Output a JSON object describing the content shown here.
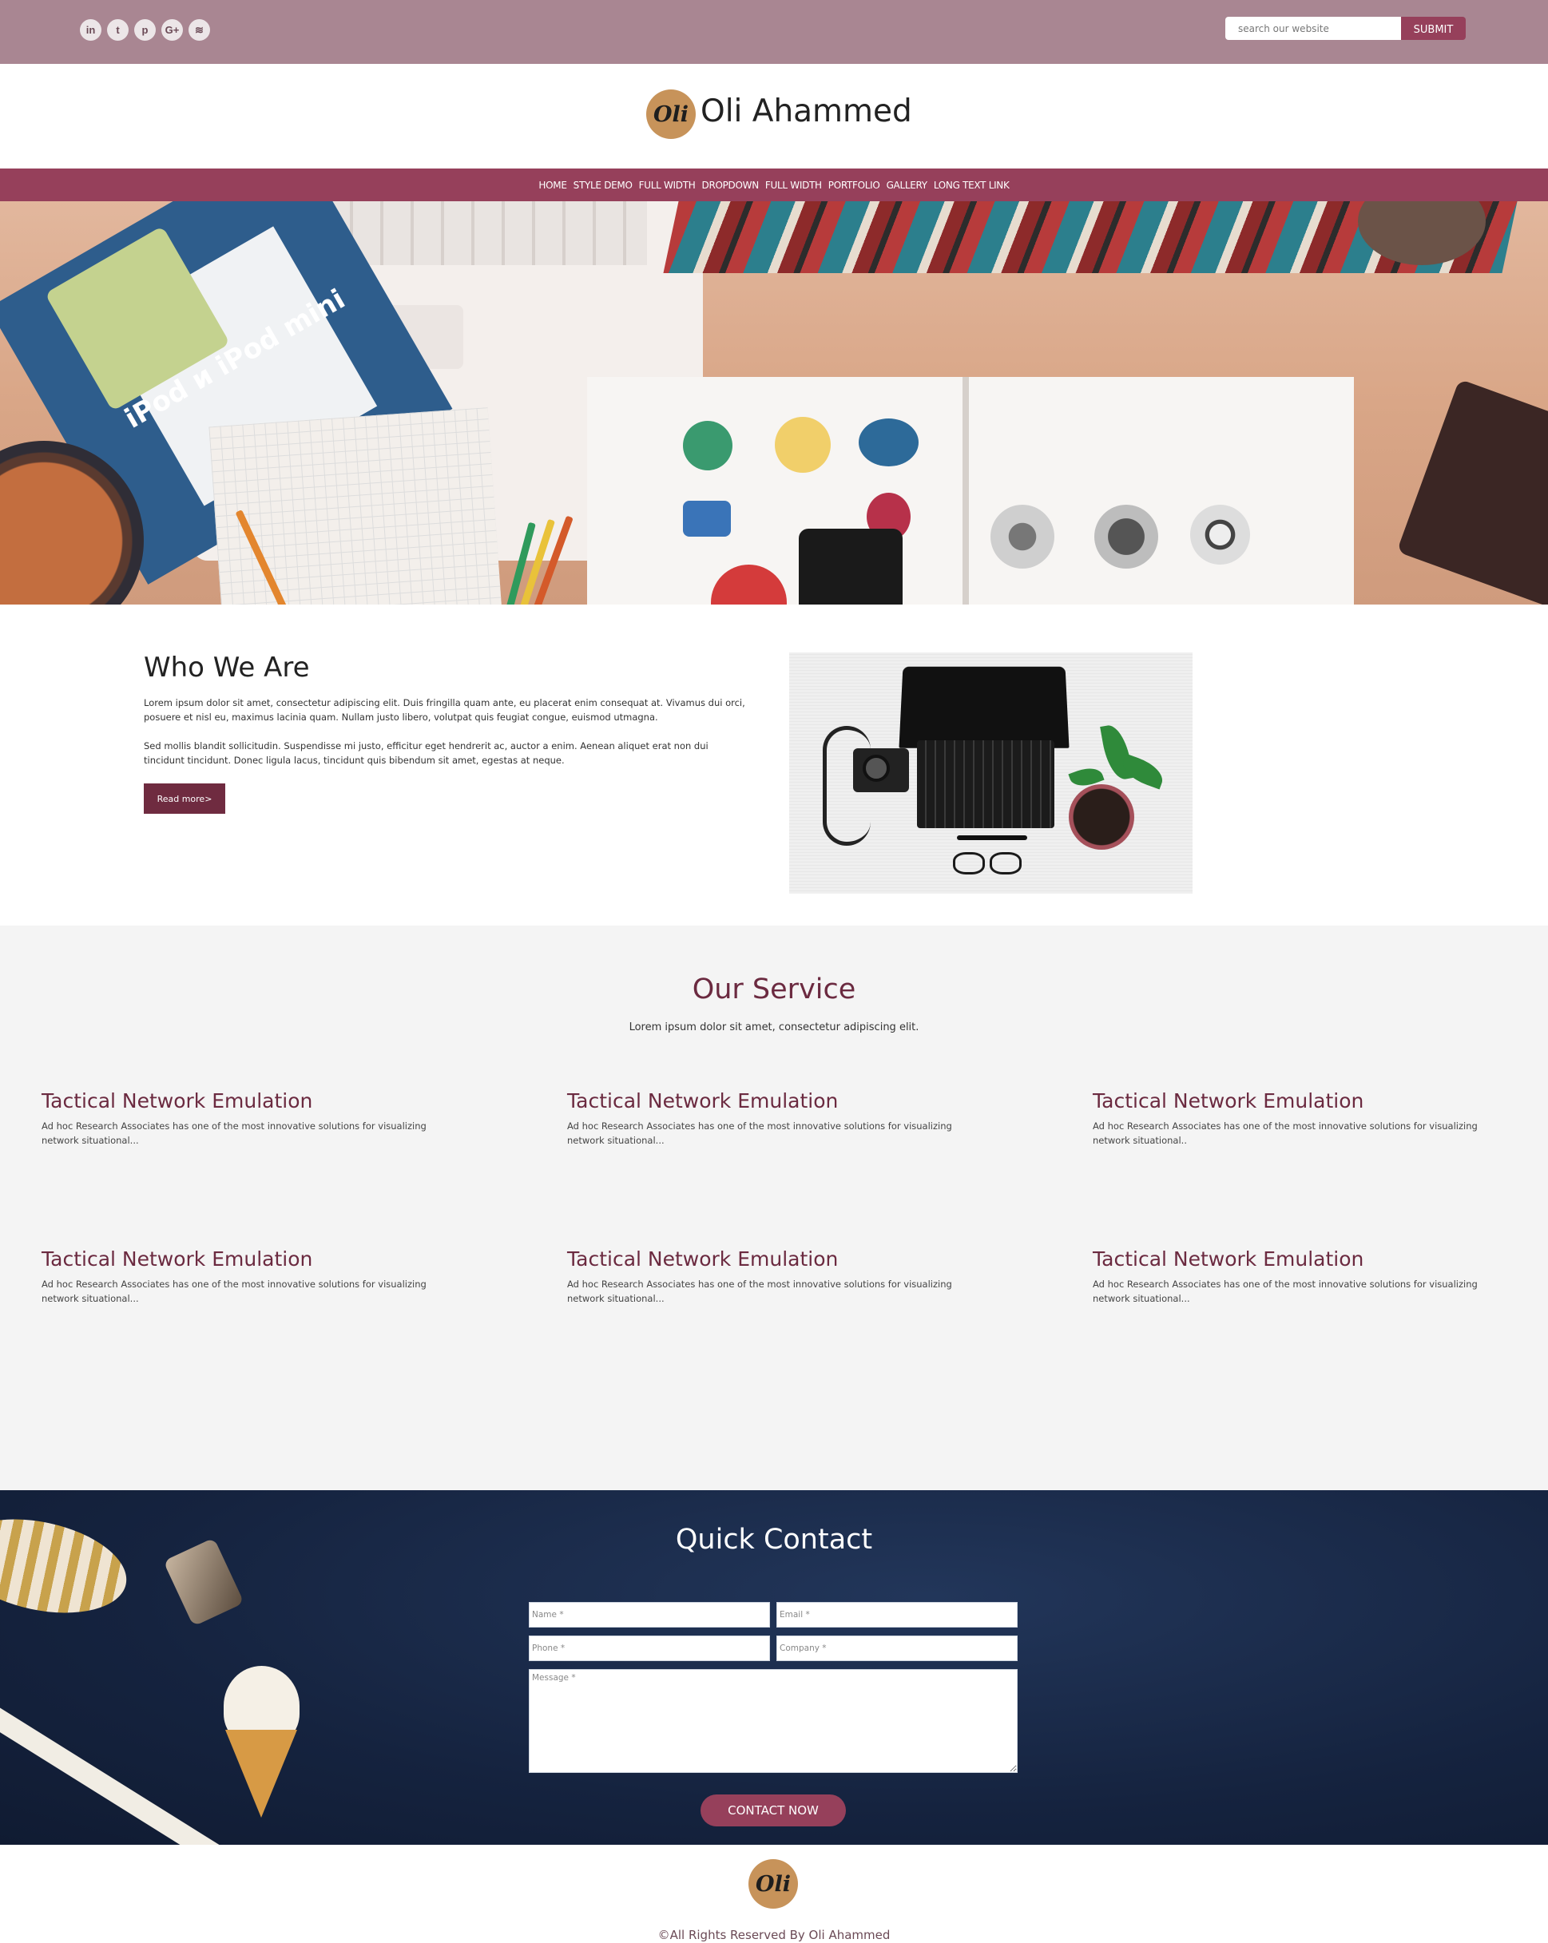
{
  "topbar": {
    "social_icons": [
      "linkedin-icon",
      "twitter-icon",
      "pinterest-icon",
      "google-plus-icon",
      "wifi-icon"
    ],
    "social_glyphs": [
      "in",
      "t",
      "p",
      "G+",
      "≋"
    ],
    "search_placeholder": "search our website",
    "submit_label": "SUBMIT"
  },
  "brand": {
    "logo_text": "Oli",
    "name": "Oli Ahammed"
  },
  "nav": {
    "items": [
      "HOME",
      "STYLE DEMO",
      "FULL WIDTH",
      "DROPDOWN",
      "FULL WIDTH",
      "PORTFOLIO",
      "GALLERY",
      "LONG TEXT LINK"
    ]
  },
  "hero": {
    "booklet_text": "iPod и iPod mini"
  },
  "about": {
    "title": "Who We Are",
    "paragraph1": "Lorem ipsum dolor sit amet, consectetur adipiscing elit. Duis fringilla quam ante, eu placerat enim consequat at. Vivamus dui orci, posuere et nisl eu, maximus lacinia quam. Nullam justo libero, volutpat quis feugiat congue, euismod utmagna.",
    "paragraph2": "Sed mollis blandit sollicitudin. Suspendisse mi justo, efficitur eget hendrerit ac, auctor a enim. Aenean aliquet erat non dui tincidunt tincidunt. Donec ligula lacus, tincidunt quis bibendum sit amet, egestas at neque.",
    "read_more": "Read more>"
  },
  "services": {
    "title": "Our Service",
    "subtitle": "Lorem ipsum dolor sit amet, consectetur adipiscing elit.",
    "items": [
      {
        "title": "Tactical Network Emulation",
        "text": "Ad hoc Research Associates has one of the most innovative solutions for visualizing network situational..."
      },
      {
        "title": "Tactical Network Emulation",
        "text": "Ad hoc Research Associates has one of the most innovative solutions for visualizing network situational..."
      },
      {
        "title": "Tactical Network Emulation",
        "text": "Ad hoc Research Associates has one of the most innovative solutions for visualizing network situational.."
      },
      {
        "title": "Tactical Network Emulation",
        "text": "Ad hoc Research Associates has one of the most innovative solutions for visualizing network situational..."
      },
      {
        "title": "Tactical Network Emulation",
        "text": "Ad hoc Research Associates has one of the most innovative solutions for visualizing network situational..."
      },
      {
        "title": "Tactical Network Emulation",
        "text": "Ad hoc Research Associates has one of the most innovative solutions for visualizing network situational..."
      }
    ]
  },
  "contact": {
    "title": "Quick Contact",
    "name_placeholder": "Name *",
    "email_placeholder": "Email *",
    "phone_placeholder": "Phone *",
    "company_placeholder": "Company *",
    "message_placeholder": "Message *",
    "button": "CONTACT NOW"
  },
  "footer": {
    "logo_text": "Oli",
    "copyright": "©All Rights Reserved By Oli Ahammed"
  }
}
